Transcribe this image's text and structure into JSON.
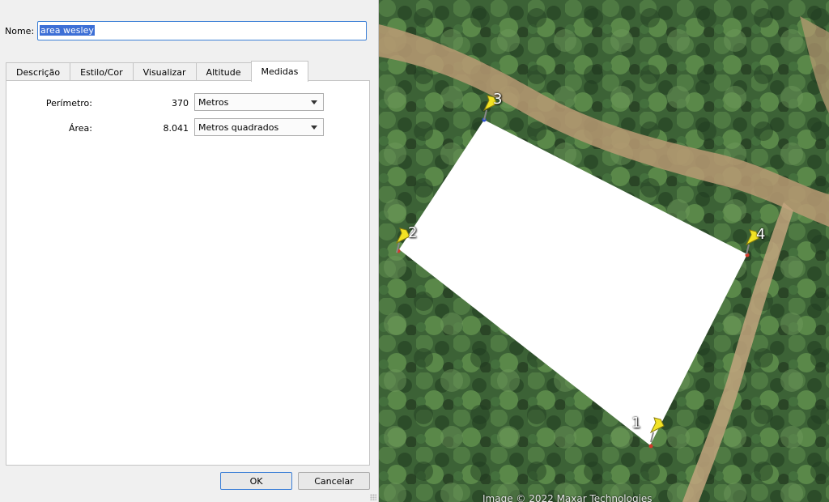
{
  "dialog": {
    "name_label": "Nome:",
    "name_value": "area wesley",
    "tabs": [
      {
        "label": "Descrição",
        "active": false
      },
      {
        "label": "Estilo/Cor",
        "active": false
      },
      {
        "label": "Visualizar",
        "active": false
      },
      {
        "label": "Altitude",
        "active": false
      },
      {
        "label": "Medidas",
        "active": true
      }
    ],
    "measures": {
      "perimeter_label": "Perímetro:",
      "perimeter_value": "370",
      "perimeter_unit": "Metros",
      "area_label": "Área:",
      "area_value": "8.041",
      "area_unit": "Metros quadrados"
    },
    "ok_label": "OK",
    "cancel_label": "Cancelar"
  },
  "map": {
    "pins": [
      {
        "label": "1"
      },
      {
        "label": "2"
      },
      {
        "label": "3"
      },
      {
        "label": "4"
      }
    ],
    "polygon_fill": "#ffffff",
    "pin_color": "#f2e324",
    "credit": "Image © 2022 Maxar Technologies"
  },
  "icons": {
    "dropdown": "chevron-down-icon",
    "pin": "pushpin-icon",
    "resize": "resize-grip-icon"
  }
}
